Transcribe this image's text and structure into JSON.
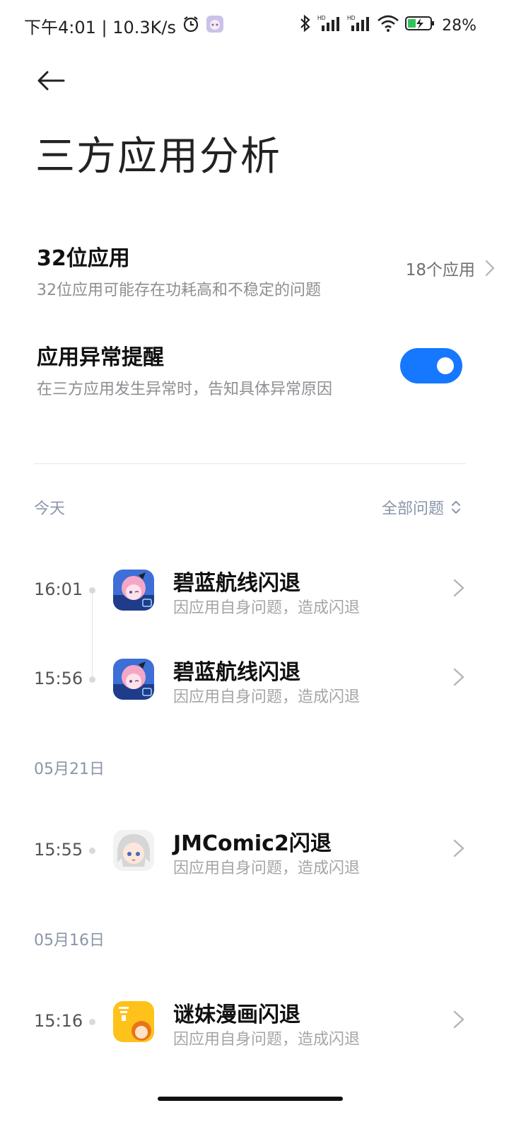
{
  "status_bar": {
    "time": "下午4:01 | 10.3K/s",
    "battery": "28%",
    "icons": [
      "alarm-icon",
      "app-avatar-icon",
      "bluetooth-icon",
      "signal-hd-icon",
      "signal-hd-icon",
      "wifi-icon",
      "battery-charging-icon"
    ]
  },
  "page": {
    "title": "三方应用分析"
  },
  "settings": {
    "apps32": {
      "title": "32位应用",
      "desc": "32位应用可能存在功耗高和不稳定的问题",
      "value": "18个应用"
    },
    "alert": {
      "title": "应用异常提醒",
      "desc": "在三方应用发生异常时，告知具体异常原因",
      "enabled": true
    }
  },
  "filter": {
    "label": "全部问题"
  },
  "sections": [
    {
      "label": "今天",
      "items": [
        {
          "time": "16:01",
          "title": "碧蓝航线闪退",
          "desc": "因应用自身问题，造成闪退",
          "icon": "azur-lane-icon"
        },
        {
          "time": "15:56",
          "title": "碧蓝航线闪退",
          "desc": "因应用自身问题，造成闪退",
          "icon": "azur-lane-icon"
        }
      ]
    },
    {
      "label": "05月21日",
      "items": [
        {
          "time": "15:55",
          "title": "JMComic2闪退",
          "desc": "因应用自身问题，造成闪退",
          "icon": "jmcomic-icon"
        }
      ]
    },
    {
      "label": "05月16日",
      "items": [
        {
          "time": "15:16",
          "title": "谜妹漫画闪退",
          "desc": "因应用自身问题，造成闪退",
          "icon": "mimei-icon"
        }
      ]
    }
  ],
  "colors": {
    "accent": "#1677ff",
    "muted": "#8a95a8",
    "desc": "#a5a5a5"
  }
}
